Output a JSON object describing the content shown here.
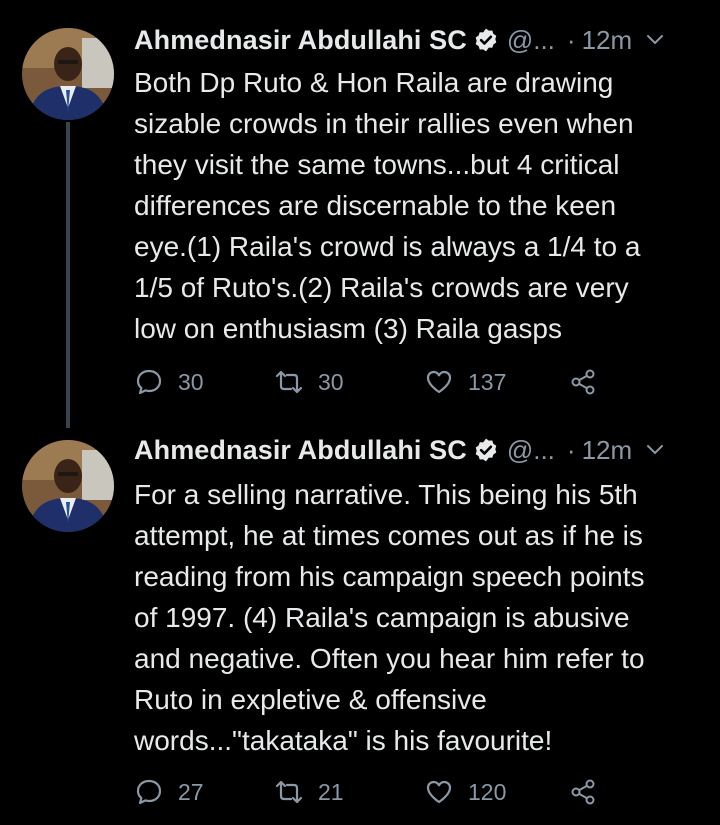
{
  "tweets": [
    {
      "author_name": "Ahmednasir Abdullahi SC",
      "handle": "@...",
      "dot": "·",
      "time": "12m",
      "text_lines": [
        "Both Dp Ruto & Hon Raila are drawing",
        "sizable crowds in their rallies even when",
        "they visit the same towns...but 4 critical",
        "differences are discernable to the keen",
        "eye.(1) Raila's crowd is always a 1/4 to a",
        "1/5 of Ruto's.(2) Raila's crowds are very",
        "low on enthusiasm (3) Raila gasps"
      ],
      "replies": "30",
      "retweets": "30",
      "likes": "137"
    },
    {
      "author_name": "Ahmednasir Abdullahi SC",
      "handle": "@...",
      "dot": "·",
      "time": "12m",
      "text_lines": [
        "For a selling narrative. This being his 5th",
        "attempt, he at times comes out as if he is",
        "reading from his campaign speech points",
        "of 1997. (4) Raila's campaign is abusive",
        "and negative. Often you hear him refer to",
        "Ruto in expletive & offensive",
        "words...\"takataka\" is his favourite!"
      ],
      "replies": "27",
      "retweets": "21",
      "likes": "120"
    }
  ],
  "icons": {
    "verified": "verified-badge-icon",
    "caret": "chevron-down-icon",
    "reply": "reply-icon",
    "retweet": "retweet-icon",
    "like": "heart-icon",
    "share": "share-icon"
  },
  "colors": {
    "background": "#000000",
    "text": "#e7e9ea",
    "muted": "#8b98a5",
    "thread_line": "#38444d"
  }
}
